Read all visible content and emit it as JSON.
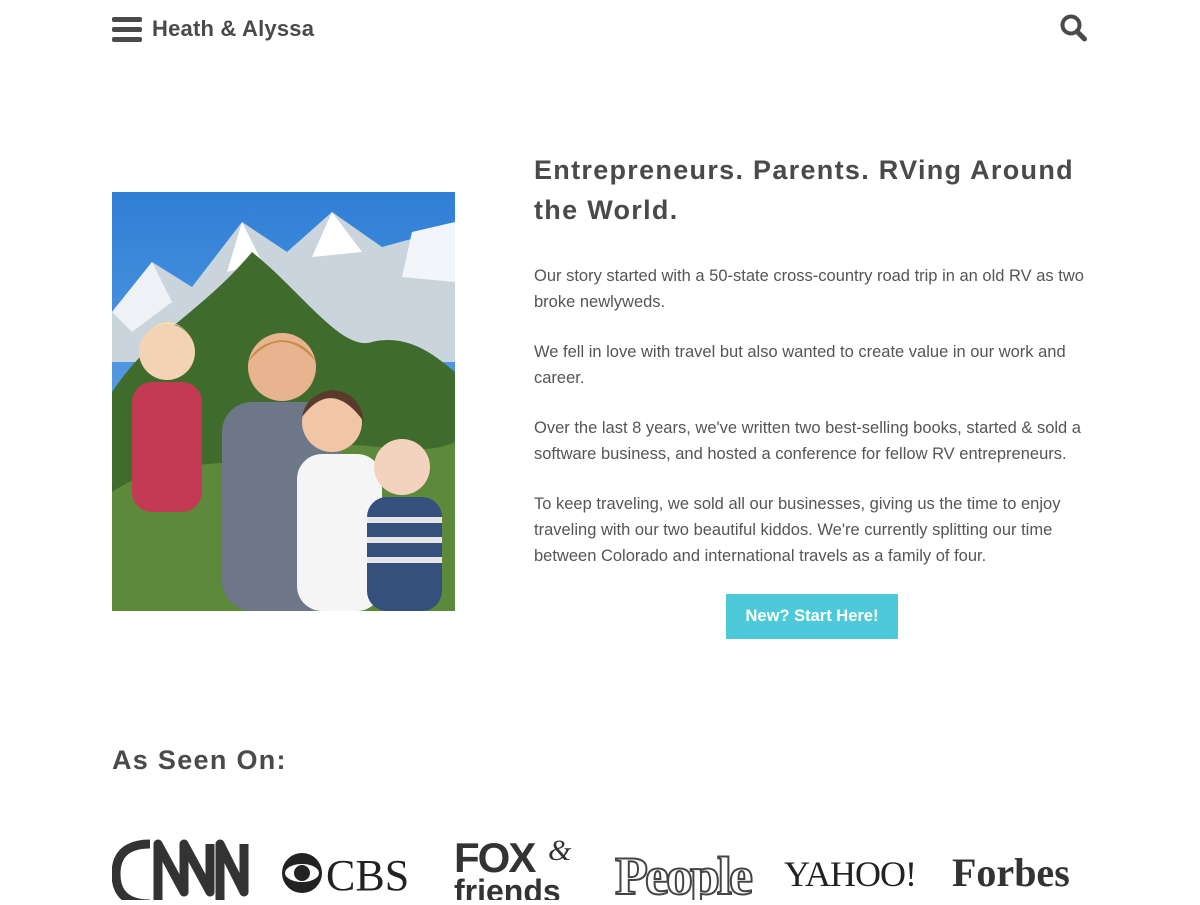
{
  "header": {
    "site_title": "Heath & Alyssa",
    "menu_icon": "hamburger-menu-icon",
    "search_icon": "search-icon"
  },
  "hero": {
    "photo_alt": "Family of four smiling in front of snowy mountains",
    "heading": "Entrepreneurs. Parents. RVing Around the World.",
    "paragraphs": [
      "Our story started with a 50-state cross-country road trip in an old RV as two broke newlyweds.",
      "We fell in love with travel but also wanted to create value in our work and career.",
      "Over the last 8 years, we've written two best-selling books, started & sold a software business, and hosted a conference for fellow RV entrepreneurs.",
      "To keep traveling, we sold all our businesses, giving us the time to enjoy traveling with our two beautiful kiddos. We're currently splitting our time between Colorado and international travels as a family of four."
    ],
    "cta_label": "New? Start Here!",
    "cta_color": "#4dc9d9"
  },
  "as_seen_on": {
    "heading": "As Seen On:",
    "logos": [
      "CNN",
      "CBS",
      "FOX & friends",
      "People",
      "YAHOO!",
      "Forbes"
    ]
  }
}
